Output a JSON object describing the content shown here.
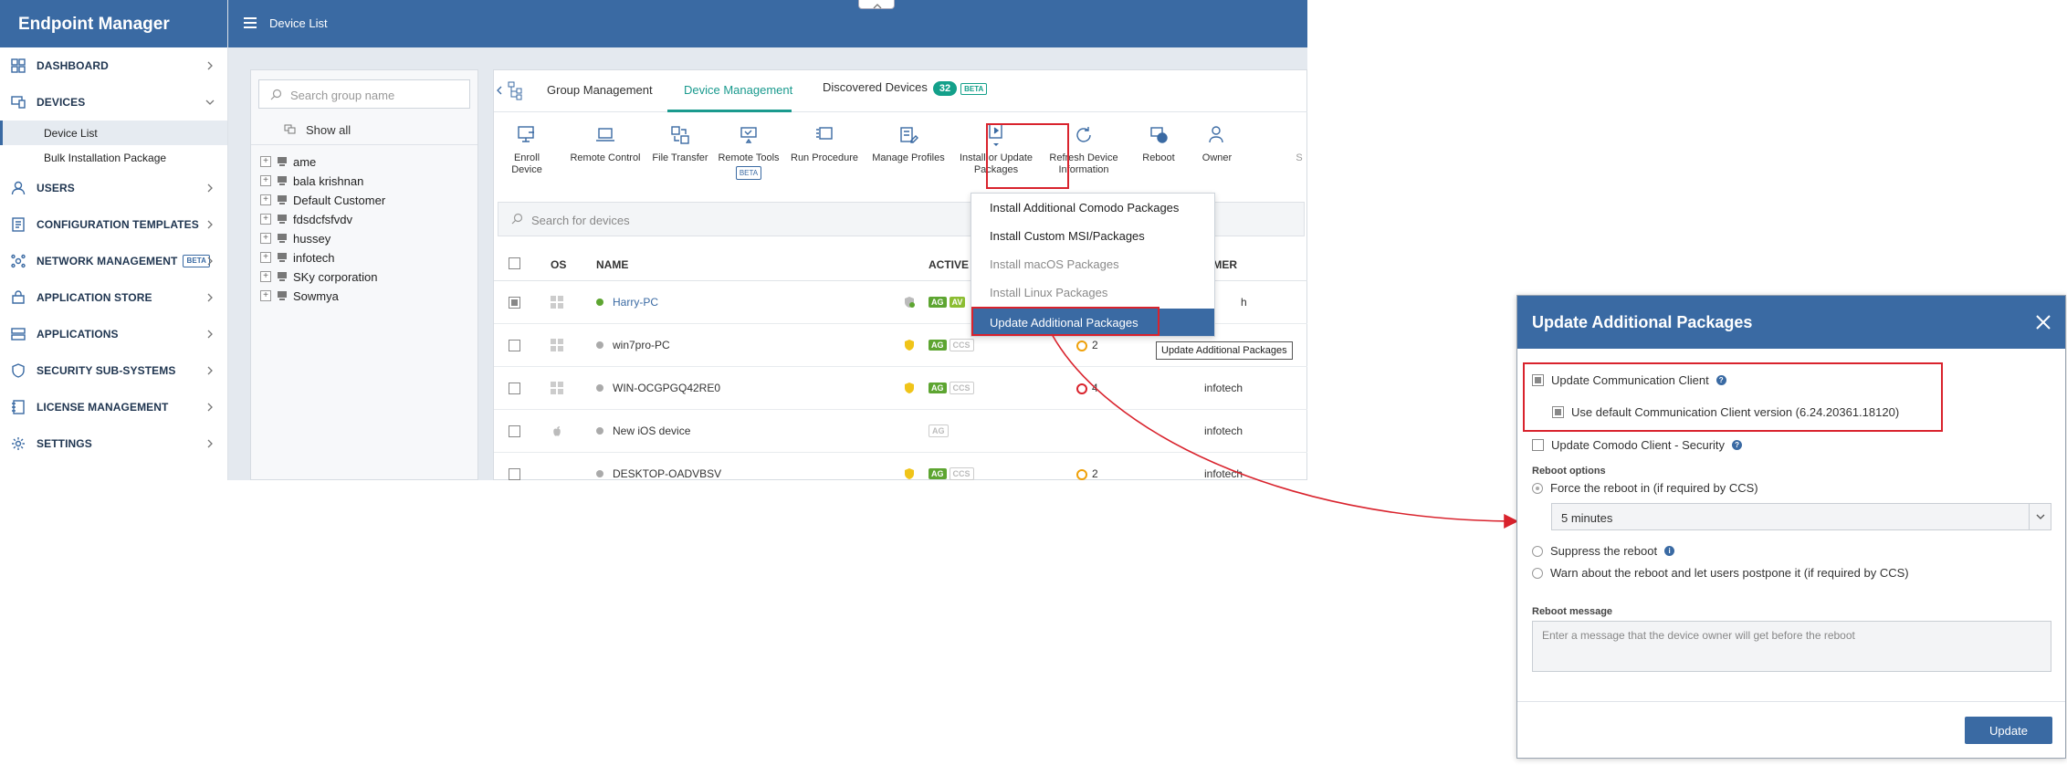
{
  "sidebar": {
    "brand": "Endpoint Manager",
    "items": [
      {
        "label": "DASHBOARD"
      },
      {
        "label": "DEVICES"
      },
      {
        "label": "USERS"
      },
      {
        "label": "CONFIGURATION TEMPLATES"
      },
      {
        "label": "NETWORK MANAGEMENT",
        "badge": "BETA"
      },
      {
        "label": "APPLICATION STORE"
      },
      {
        "label": "APPLICATIONS"
      },
      {
        "label": "SECURITY SUB-SYSTEMS"
      },
      {
        "label": "LICENSE MANAGEMENT"
      },
      {
        "label": "SETTINGS"
      }
    ],
    "sub_items": [
      {
        "label": "Device List"
      },
      {
        "label": "Bulk Installation Package"
      }
    ]
  },
  "header": {
    "breadcrumb": "Device List"
  },
  "groups": {
    "search_placeholder": "Search group name",
    "show_all": "Show all",
    "items": [
      "ame",
      "bala krishnan",
      "Default Customer",
      "fdsdcfsfvdv",
      "hussey",
      "infotech",
      "SKy corporation",
      "Sowmya"
    ]
  },
  "tabs": [
    {
      "label": "Group Management"
    },
    {
      "label": "Device Management"
    },
    {
      "label": "Discovered Devices",
      "count": "32",
      "badge": "BETA"
    }
  ],
  "toolbar": [
    {
      "label": "Enroll Device"
    },
    {
      "label": "Remote Control"
    },
    {
      "label": "File Transfer"
    },
    {
      "label": "Remote Tools",
      "badge": "BETA"
    },
    {
      "label": "Run Procedure"
    },
    {
      "label": "Manage Profiles"
    },
    {
      "label": "Install or Update Packages"
    },
    {
      "label": "Refresh Device Information"
    },
    {
      "label": "Reboot"
    },
    {
      "label": "Owner"
    },
    {
      "label": "S"
    }
  ],
  "device_search": {
    "placeholder": "Search for devices"
  },
  "table": {
    "headers": {
      "os": "OS",
      "name": "NAME",
      "active": "ACTIVE C",
      "customer": "OMER"
    },
    "rows": [
      {
        "name": "Harry-PC",
        "tags": [
          "AG",
          "AV"
        ],
        "customer": "h"
      },
      {
        "name": "win7pro-PC",
        "tags": [
          "AG",
          "CCS"
        ],
        "alerts": "2",
        "customer": ""
      },
      {
        "name": "WIN-OCGPGQ42RE0",
        "tags": [
          "AG",
          "CCS"
        ],
        "alerts": "4",
        "customer": "infotech"
      },
      {
        "name": "New iOS device",
        "tags": [
          "AG"
        ],
        "customer": "infotech"
      },
      {
        "name": "DESKTOP-OADVBSV",
        "tags": [
          "AG",
          "CCS"
        ],
        "alerts": "2",
        "customer": "infotech"
      }
    ]
  },
  "dropdown": {
    "items": [
      {
        "label": "Install Additional Comodo Packages"
      },
      {
        "label": "Install Custom MSI/Packages"
      },
      {
        "label": "Install macOS Packages"
      },
      {
        "label": "Install Linux Packages"
      },
      {
        "label": "Update Additional Packages"
      }
    ],
    "tooltip": "Update Additional Packages"
  },
  "dialog": {
    "title": "Update Additional Packages",
    "update_comm_client": "Update Communication Client",
    "use_default_version": "Use default Communication Client version (6.24.20361.18120)",
    "update_comodo_client": "Update Comodo Client - Security",
    "reboot_options_label": "Reboot options",
    "force_reboot": "Force the reboot in (if required by CCS)",
    "reboot_delay": "5 minutes",
    "suppress_reboot": "Suppress the reboot",
    "warn_reboot": "Warn about the reboot and let users postpone it (if required by CCS)",
    "reboot_message_label": "Reboot message",
    "reboot_message_placeholder": "Enter a message that the device owner will get before the reboot",
    "update_button": "Update"
  },
  "colors": {
    "brand": "#3a6aa3",
    "accent": "#1a9a8e",
    "highlight": "#d9232d"
  }
}
